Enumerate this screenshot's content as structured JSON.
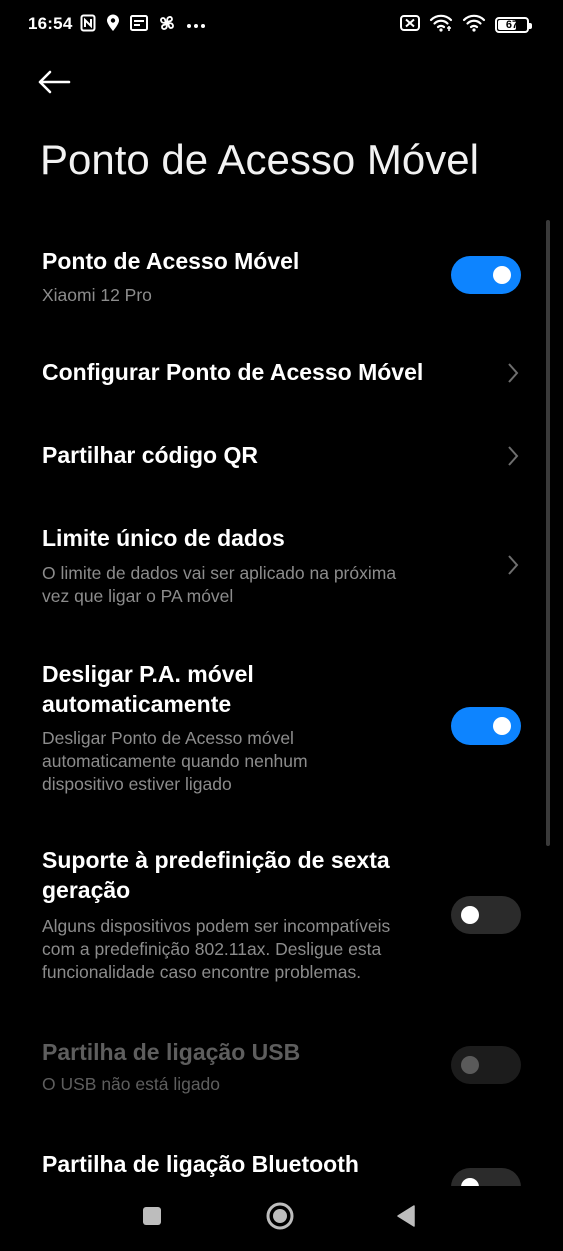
{
  "status_bar": {
    "time": "16:54",
    "left_icons": [
      "nfc-icon",
      "location-icon",
      "notification-icon",
      "fan-icon",
      "more-dots-icon"
    ],
    "right_icons": [
      "no-sim-icon",
      "hotspot-wifi-icon",
      "wifi-icon"
    ],
    "battery_level": "67",
    "battery_fraction": 0.67
  },
  "header": {
    "back_icon": "arrow-left-icon",
    "title": "Ponto de Acesso Móvel"
  },
  "settings": {
    "hotspot": {
      "title": "Ponto de Acesso Móvel",
      "subtitle": "Xiaomi 12 Pro",
      "enabled": true
    },
    "configure": {
      "title": "Configurar Ponto de Acesso Móvel"
    },
    "share_qr": {
      "title": "Partilhar código QR"
    },
    "data_limit": {
      "title": "Limite único de dados",
      "subtitle_line1": "O limite de dados vai ser aplicado na próxima",
      "subtitle_line2": "vez que ligar o PA móvel"
    },
    "auto_off": {
      "title_line1": "Desligar P.A. móvel",
      "title_line2": "automaticamente",
      "subtitle_line1": "Desligar Ponto de Acesso móvel",
      "subtitle_line2": "automaticamente quando nenhum",
      "subtitle_line3": "dispositivo estiver ligado",
      "enabled": true
    },
    "wifi6": {
      "title_line1": "Suporte à predefinição de sexta",
      "title_line2": "geração",
      "subtitle_line1": "Alguns dispositivos podem ser incompatíveis",
      "subtitle_line2": "com a predefinição 802.11ax. Desligue esta",
      "subtitle_line3": "funcionalidade caso encontre problemas.",
      "enabled": false
    },
    "usb_tethering": {
      "title": "Partilha de ligação USB",
      "subtitle": "O USB não está ligado",
      "enabled": false,
      "disabled": true
    },
    "bluetooth_tethering": {
      "title": "Partilha de ligação Bluetooth",
      "enabled": false
    }
  },
  "colors": {
    "accent": "#0d84ff",
    "background": "#000000",
    "subtitle": "#8c8c8c",
    "toggle_off": "#2b2b2b"
  },
  "nav_bar": {
    "buttons": [
      "recents-square-icon",
      "home-circle-icon",
      "back-triangle-icon"
    ]
  }
}
